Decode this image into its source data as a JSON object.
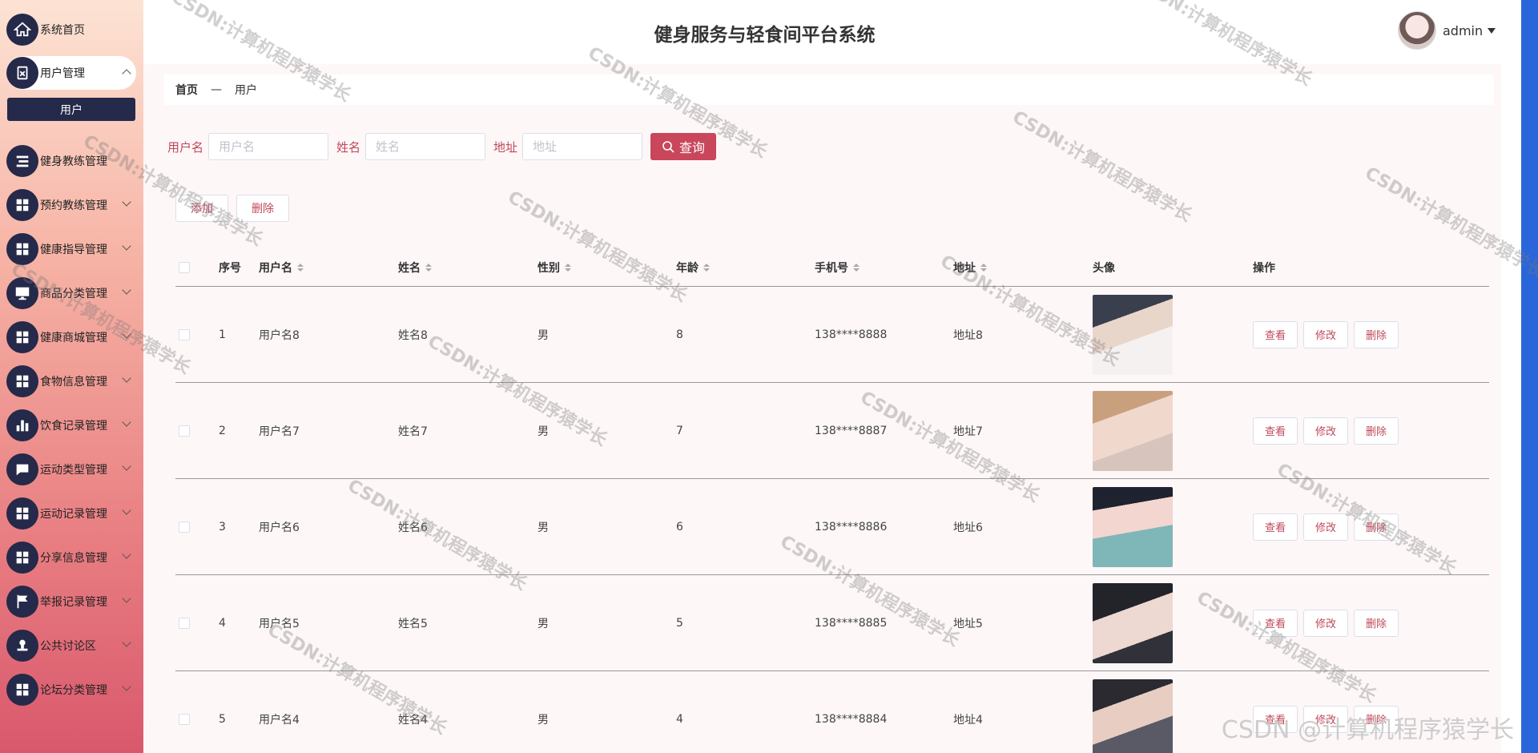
{
  "sidebar": {
    "items": [
      {
        "label": "系统首页",
        "icon": "home-icon"
      },
      {
        "label": "用户管理",
        "icon": "clipboard-icon",
        "expanded": true,
        "sub": "用户"
      },
      {
        "label": "健身教练管理",
        "icon": "list-icon"
      },
      {
        "label": "预约教练管理",
        "icon": "grid-icon"
      },
      {
        "label": "健康指导管理",
        "icon": "grid-icon"
      },
      {
        "label": "商品分类管理",
        "icon": "monitor-icon"
      },
      {
        "label": "健康商城管理",
        "icon": "grid-icon"
      },
      {
        "label": "食物信息管理",
        "icon": "grid-icon"
      },
      {
        "label": "饮食记录管理",
        "icon": "bar-chart-icon"
      },
      {
        "label": "运动类型管理",
        "icon": "chat-icon"
      },
      {
        "label": "运动记录管理",
        "icon": "grid-icon"
      },
      {
        "label": "分享信息管理",
        "icon": "grid-icon"
      },
      {
        "label": "举报记录管理",
        "icon": "flag-icon"
      },
      {
        "label": "公共讨论区",
        "icon": "stamp-icon"
      },
      {
        "label": "论坛分类管理",
        "icon": "grid-icon"
      }
    ]
  },
  "header": {
    "title": "健身服务与轻食间平台系统",
    "username": "admin"
  },
  "breadcrumb": {
    "home": "首页",
    "sep": "—",
    "current": "用户"
  },
  "search": {
    "username_label": "用户名",
    "username_placeholder": "用户名",
    "name_label": "姓名",
    "name_placeholder": "姓名",
    "address_label": "地址",
    "address_placeholder": "地址",
    "query_label": "查询"
  },
  "toolbar": {
    "add_label": "添加",
    "delete_label": "删除"
  },
  "table": {
    "headers": [
      "序号",
      "用户名",
      "姓名",
      "性别",
      "年龄",
      "手机号",
      "地址",
      "头像",
      "操作"
    ],
    "rows": [
      {
        "idx": "1",
        "username": "用户名8",
        "name": "姓名8",
        "sex": "男",
        "age": "8",
        "phone": "138****8888",
        "address": "地址8"
      },
      {
        "idx": "2",
        "username": "用户名7",
        "name": "姓名7",
        "sex": "男",
        "age": "7",
        "phone": "138****8887",
        "address": "地址7"
      },
      {
        "idx": "3",
        "username": "用户名6",
        "name": "姓名6",
        "sex": "男",
        "age": "6",
        "phone": "138****8886",
        "address": "地址6"
      },
      {
        "idx": "4",
        "username": "用户名5",
        "name": "姓名5",
        "sex": "男",
        "age": "5",
        "phone": "138****8885",
        "address": "地址5"
      },
      {
        "idx": "5",
        "username": "用户名4",
        "name": "姓名4",
        "sex": "男",
        "age": "4",
        "phone": "138****8884",
        "address": "地址4"
      }
    ],
    "op_view": "查看",
    "op_edit": "修改",
    "op_delete": "删除"
  },
  "watermark": {
    "text": "CSDN:计算机程序猿学长",
    "corner": "CSDN @计算机程序猿学长"
  },
  "colors": {
    "accent": "#c9465b",
    "nav_dark": "#25294a"
  }
}
